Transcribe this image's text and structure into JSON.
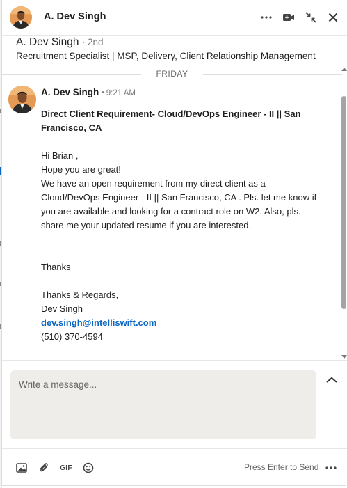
{
  "header": {
    "name": "A. Dev Singh",
    "more_icon": "more-horizontal-icon",
    "video_icon": "video-call-icon",
    "minimize_icon": "minimize-arrows-icon",
    "close_icon": "close-icon"
  },
  "profile": {
    "name": "A. Dev Singh",
    "degree": "· 2nd",
    "headline": "Recruitment Specialist | MSP, Delivery, Client Relationship Management"
  },
  "day_divider": "FRIDAY",
  "message": {
    "sender": "A. Dev Singh",
    "dot": "•",
    "time": "9:21 AM",
    "subject": "Direct Client Requirement- Cloud/DevOps Engineer - II || San Francisco, CA",
    "greeting": "Hi Brian ,",
    "line1": "Hope you are great!",
    "paragraph": "We have an open requirement from my direct client as a Cloud/DevOps Engineer - II || San Francisco, CA . Pls. let me know if you are available and looking for a contract role on W2. Also, pls. share me your updated resume if you are interested.",
    "thanks": "Thanks",
    "regards": "Thanks & Regards,",
    "signature_name": "Dev Singh",
    "email": "dev.singh@intelliswift.com",
    "phone": "(510) 370-4594"
  },
  "compose": {
    "placeholder": "Write a message...",
    "expand_icon": "chevron-up-icon"
  },
  "footer": {
    "image_icon": "image-icon",
    "attach_icon": "paperclip-icon",
    "gif_label": "GIF",
    "emoji_icon": "emoji-icon",
    "send_hint": "Press Enter to Send",
    "more_icon": "more-horizontal-icon"
  },
  "colors": {
    "link": "#0a66c2",
    "text": "#1d1d1d",
    "muted": "#666666",
    "compose_bg": "#eeede9",
    "scroll_thumb": "#a4a4a4"
  }
}
